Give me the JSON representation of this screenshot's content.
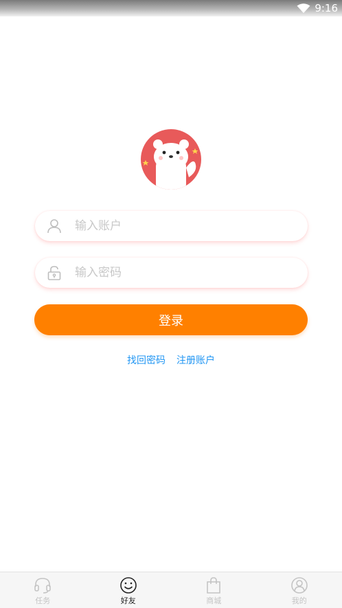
{
  "status_bar": {
    "time": "9:16"
  },
  "login": {
    "account_placeholder": "输入账户",
    "password_placeholder": "输入密码",
    "button_label": "登录"
  },
  "links": {
    "forgot_password": "找回密码",
    "register": "注册账户"
  },
  "bottom_nav": {
    "items": [
      {
        "label": "任务",
        "icon": "headset-icon",
        "active": false
      },
      {
        "label": "好友",
        "icon": "smiley-icon",
        "active": true
      },
      {
        "label": "商城",
        "icon": "shopping-bag-icon",
        "active": false
      },
      {
        "label": "我的",
        "icon": "user-circle-icon",
        "active": false
      }
    ]
  },
  "colors": {
    "accent": "#ff8000",
    "link": "#2196f3",
    "avatar_bg": "#e85a5a"
  }
}
